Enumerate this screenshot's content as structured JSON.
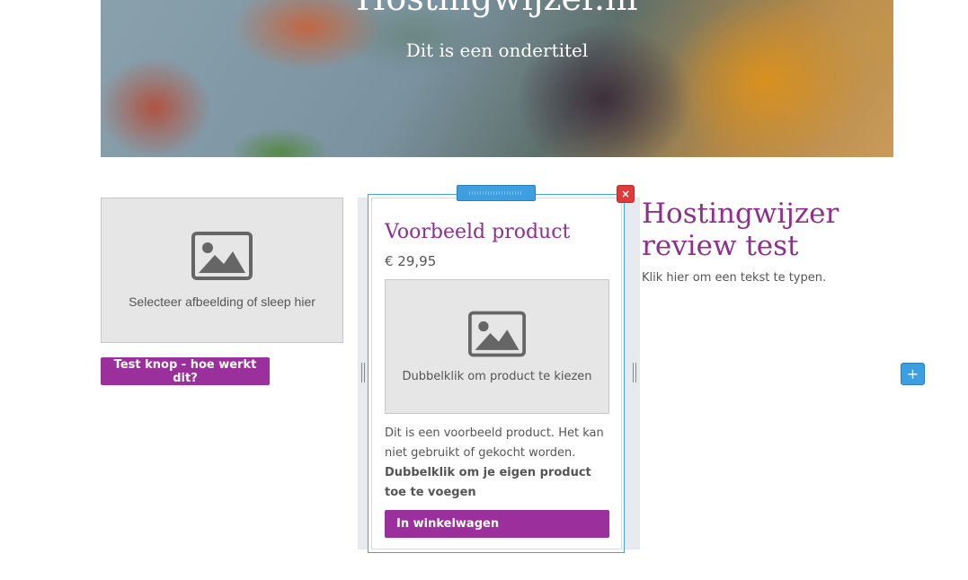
{
  "hero": {
    "title": "Hostingwijzer.nl",
    "subtitle": "Dit is een ondertitel"
  },
  "left": {
    "image_caption": "Selecteer afbeelding of sleep hier",
    "button_label": "Test knop - hoe werkt dit?"
  },
  "product": {
    "title": "Voorbeeld product",
    "price": "€ 29,95",
    "image_caption": "Dubbelklik om product te kiezen",
    "description": "Dit is een voorbeeld product. Het kan niet gebruikt of gekocht worden.",
    "description_bold": "Dubbelklik om je eigen product toe te voegen",
    "cart_label": "In winkelwagen"
  },
  "editor": {
    "close_label": "×",
    "add_label": "+"
  },
  "right": {
    "title": "Hostingwijzer review test",
    "text": "Klik hier om een tekst te typen."
  },
  "colors": {
    "accent_purple": "#9b2f9b",
    "heading_purple": "#8e2f8e",
    "editor_blue": "#3d9ee0",
    "close_red": "#e03a3a"
  },
  "icons": {
    "image_placeholder": "image-icon",
    "close": "close-icon",
    "add": "plus-icon",
    "drag": "drag-handle-icon",
    "resize": "resize-handle-icon"
  }
}
